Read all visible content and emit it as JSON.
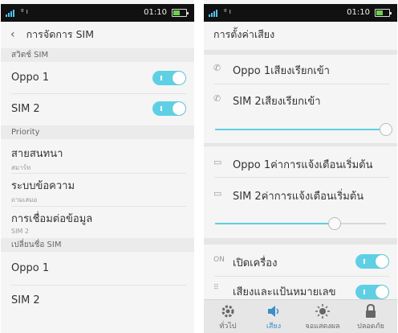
{
  "status_bar": {
    "time": "01:10"
  },
  "left_screen": {
    "title": "การจัดการ SIM",
    "section_sim_switch": "สวิตช์ SIM",
    "sim1_label": "Oppo 1",
    "sim2_label": "SIM 2",
    "section_priority": "Priority",
    "call_label": "สายสนทนา",
    "call_value": "สมาร์ท",
    "sms_label": "ระบบข้อความ",
    "sms_value": "ถามเสมอ",
    "data_label": "การเชื่อมต่อข้อมูล",
    "data_value": "SIM 2",
    "section_rename": "เปลี่ยนชื่อ SIM",
    "rename_sim1": "Oppo 1",
    "rename_sim2": "SIM 2"
  },
  "right_screen": {
    "title": "การตั้งค่าเสียง",
    "ringtone1": "Oppo 1เสียงเรียกเข้า",
    "ringtone2": "SIM 2เสียงเรียกเข้า",
    "ring_volume": 1.0,
    "notif1": "Oppo 1ค่าการแจ้งเตือนเริ่มต้น",
    "notif2": "SIM 2ค่าการแจ้งเตือนเริ่มต้น",
    "notif_volume": 0.7,
    "power_on_badge": "ON",
    "power_on_label": "เปิดเครื่อง",
    "dialpad_label": "เสียงและแป้นหมายเลข",
    "nav": [
      "ทั่วไป",
      "เสียง",
      "จอแสดงผล",
      "ปลอดภัย"
    ],
    "active_nav": 1
  },
  "colors": {
    "accent": "#5fd0e4",
    "active_nav": "#3a8fc7"
  }
}
